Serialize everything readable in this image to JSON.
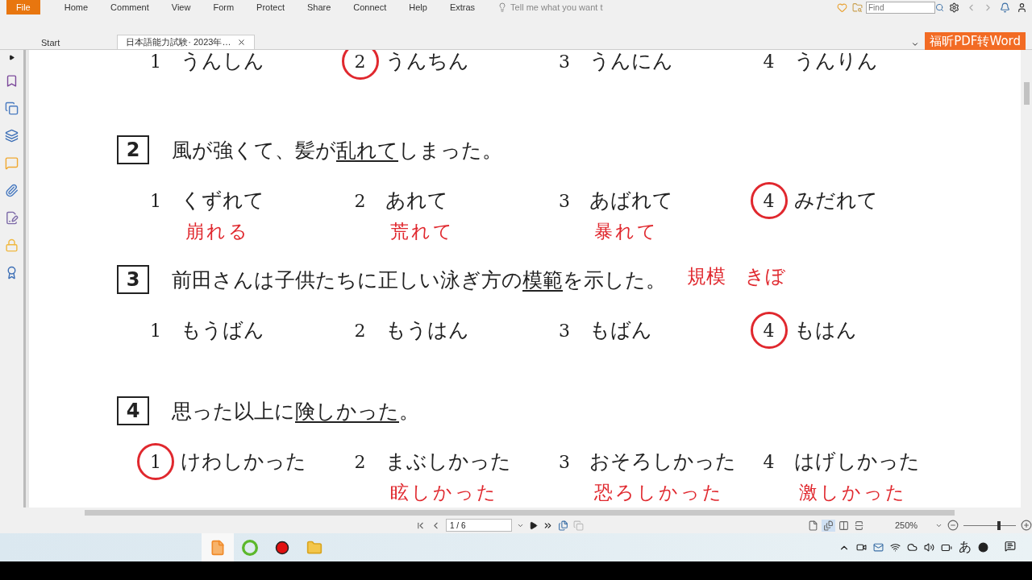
{
  "menu": {
    "items": [
      {
        "label": "File",
        "selected": true
      },
      {
        "label": "Home",
        "selected": false
      },
      {
        "label": "Comment",
        "selected": false
      },
      {
        "label": "View",
        "selected": false
      },
      {
        "label": "Form",
        "selected": false
      },
      {
        "label": "Protect",
        "selected": false
      },
      {
        "label": "Share",
        "selected": false
      },
      {
        "label": "Connect",
        "selected": false
      },
      {
        "label": "Help",
        "selected": false
      },
      {
        "label": "Extras",
        "selected": false
      }
    ],
    "tell_me": {
      "placeholder": "Tell me what you want t"
    },
    "find": {
      "placeholder": "Find"
    },
    "convert_button": "福昕PDF转Word"
  },
  "tabs": [
    {
      "label": "Start",
      "selected": false
    },
    {
      "label": "日本語能力試験· 2023年…",
      "selected": true
    }
  ],
  "questions": [
    {
      "options": [
        {
          "number": "1",
          "text": "うんしん",
          "circled": false
        },
        {
          "number": "2",
          "text": "うんちん",
          "circled": true
        },
        {
          "number": "3",
          "text": "うんにん",
          "circled": false
        },
        {
          "number": "4",
          "text": "うんりん",
          "circled": false
        }
      ]
    },
    {
      "number": "2",
      "before": "風が強くて、髪が",
      "underlined": "乱れて",
      "after": "しまった。",
      "options": [
        {
          "number": "1",
          "text": "くずれて",
          "circled": false,
          "note": "崩れる"
        },
        {
          "number": "2",
          "text": "あれて",
          "circled": false,
          "note": "荒れて"
        },
        {
          "number": "3",
          "text": "あばれて",
          "circled": false,
          "note": "暴れて"
        },
        {
          "number": "4",
          "text": "みだれて",
          "circled": true
        }
      ]
    },
    {
      "number": "3",
      "before": "前田さんは子供たちに正しい泳ぎ方の",
      "underlined": "模範",
      "after": "を示した。",
      "side_note": "規模　きぼ",
      "options": [
        {
          "number": "1",
          "text": "もうばん",
          "circled": false
        },
        {
          "number": "2",
          "text": "もうはん",
          "circled": false
        },
        {
          "number": "3",
          "text": "もばん",
          "circled": false
        },
        {
          "number": "4",
          "text": "もはん",
          "circled": true
        }
      ]
    },
    {
      "number": "4",
      "before": "思った以上に",
      "underlined": "険しかった",
      "after": "。",
      "options": [
        {
          "number": "1",
          "text": "けわしかった",
          "circled": true
        },
        {
          "number": "2",
          "text": "まぶしかった",
          "circled": false,
          "note": "眩しかった"
        },
        {
          "number": "3",
          "text": "おそろしかった",
          "circled": false,
          "note": "恐ろしかった"
        },
        {
          "number": "4",
          "text": "はげしかった",
          "circled": false,
          "note": "激しかった"
        }
      ]
    }
  ],
  "status_bar": {
    "page": "1 / 6",
    "views": [
      {
        "kind": "single",
        "selected": false
      },
      {
        "kind": "continuous",
        "selected": true
      },
      {
        "kind": "facing",
        "selected": false
      },
      {
        "kind": "split",
        "selected": false
      }
    ],
    "zoom": "250%",
    "zoom_level": {
      "level": 0.67
    }
  },
  "taskbar": {
    "apps": [
      {
        "kind": "pdf"
      },
      {
        "kind": "browser"
      },
      {
        "kind": "record"
      },
      {
        "kind": "folder"
      }
    ],
    "ime": "あ"
  }
}
